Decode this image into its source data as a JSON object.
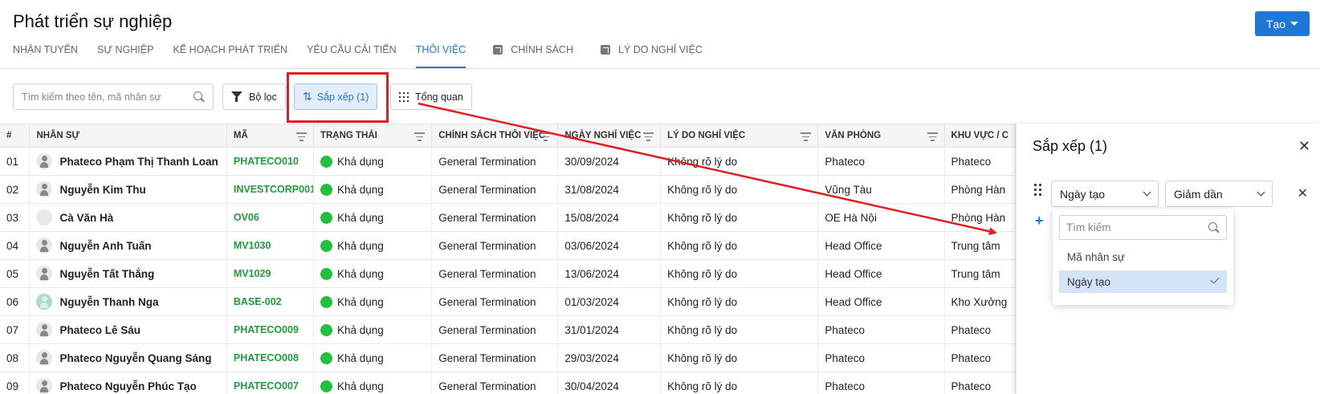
{
  "page": {
    "title": "Phát triển sự nghiệp",
    "create_label": "Tạo"
  },
  "tabs": [
    {
      "label": "NHẬN TUYỂN"
    },
    {
      "label": "SỰ NGHIỆP"
    },
    {
      "label": "KẾ HOẠCH PHÁT TRIỂN"
    },
    {
      "label": "YÊU CẦU CẢI TIẾN"
    },
    {
      "label": "THÔI VIỆC",
      "active": true
    },
    {
      "label": "CHÍNH SÁCH",
      "external": true
    },
    {
      "label": "LÝ DO NGHỈ VIỆC",
      "external": true
    }
  ],
  "toolbar": {
    "search_placeholder": "Tìm kiếm theo tên, mã nhân sự",
    "filter_label": "Bộ lọc",
    "sort_label": "Sắp xếp (1)",
    "overview_label": "Tổng quan"
  },
  "table": {
    "headers": [
      "#",
      "NHÂN SỰ",
      "MÃ",
      "TRẠNG THÁI",
      "CHÍNH SÁCH THÔI VIỆC",
      "NGÀY NGHỈ VIỆC",
      "LÝ DO NGHỈ VIỆC",
      "VĂN PHÒNG",
      "KHU VỰC / C"
    ],
    "rows": [
      {
        "num": "01",
        "name": "Phateco Phạm Thị Thanh Loan",
        "code": "PHATECO010",
        "status": "Khả dụng",
        "policy": "General Termination",
        "date": "30/09/2024",
        "reason": "Không rõ lý do",
        "office": "Phateco",
        "area": "Phateco",
        "avatar": "person"
      },
      {
        "num": "02",
        "name": "Nguyễn Kim Thu",
        "code": "INVESTCORP001",
        "status": "Khả dụng",
        "policy": "General Termination",
        "date": "31/08/2024",
        "reason": "Không rõ lý do",
        "office": "Vũng Tàu",
        "area": "Phòng Hàn",
        "avatar": "person"
      },
      {
        "num": "03",
        "name": "Cà Văn Hà",
        "code": "OV06",
        "status": "Khả dụng",
        "policy": "General Termination",
        "date": "15/08/2024",
        "reason": "Không rõ lý do",
        "office": "OE Hà Nội",
        "area": "Phòng Hàn",
        "avatar": "empty"
      },
      {
        "num": "04",
        "name": "Nguyễn Anh Tuấn",
        "code": "MV1030",
        "status": "Khả dụng",
        "policy": "General Termination",
        "date": "03/06/2024",
        "reason": "Không rõ lý do",
        "office": "Head Office",
        "area": "Trung tâm",
        "avatar": "person"
      },
      {
        "num": "05",
        "name": "Nguyễn Tất Thắng",
        "code": "MV1029",
        "status": "Khả dụng",
        "policy": "General Termination",
        "date": "13/06/2024",
        "reason": "Không rõ lý do",
        "office": "Head Office",
        "area": "Trung tâm",
        "avatar": "person"
      },
      {
        "num": "06",
        "name": "Nguyễn Thanh Nga",
        "code": "BASE-002",
        "status": "Khả dụng",
        "policy": "General Termination",
        "date": "01/03/2024",
        "reason": "Không rõ lý do",
        "office": "Head Office",
        "area": "Kho Xưởng",
        "avatar": "green"
      },
      {
        "num": "07",
        "name": "Phateco Lê Sáu",
        "code": "PHATECO009",
        "status": "Khả dụng",
        "policy": "General Termination",
        "date": "31/01/2024",
        "reason": "Không rõ lý do",
        "office": "Phateco",
        "area": "Phateco",
        "avatar": "person"
      },
      {
        "num": "08",
        "name": "Phateco Nguyễn Quang Sáng",
        "code": "PHATECO008",
        "status": "Khả dụng",
        "policy": "General Termination",
        "date": "29/03/2024",
        "reason": "Không rõ lý do",
        "office": "Phateco",
        "area": "Phateco",
        "avatar": "person"
      },
      {
        "num": "09",
        "name": "Phateco Nguyễn Phúc Tạo",
        "code": "PHATECO007",
        "status": "Khả dụng",
        "policy": "General Termination",
        "date": "30/04/2024",
        "reason": "Không rõ lý do",
        "office": "Phateco",
        "area": "Phateco",
        "avatar": "person"
      }
    ]
  },
  "sort_panel": {
    "title": "Sắp xếp (1)",
    "field_value": "Ngày tạo",
    "direction_value": "Giảm dần",
    "dropdown": {
      "search_placeholder": "Tìm kiếm",
      "options": [
        {
          "label": "Mã nhân sự",
          "selected": false
        },
        {
          "label": "Ngày tạo",
          "selected": true
        }
      ]
    }
  },
  "colors": {
    "accent": "#1e78d6",
    "status_green": "#22c03c",
    "code_green": "#1f9d3a",
    "annotation_red": "#e02020"
  }
}
